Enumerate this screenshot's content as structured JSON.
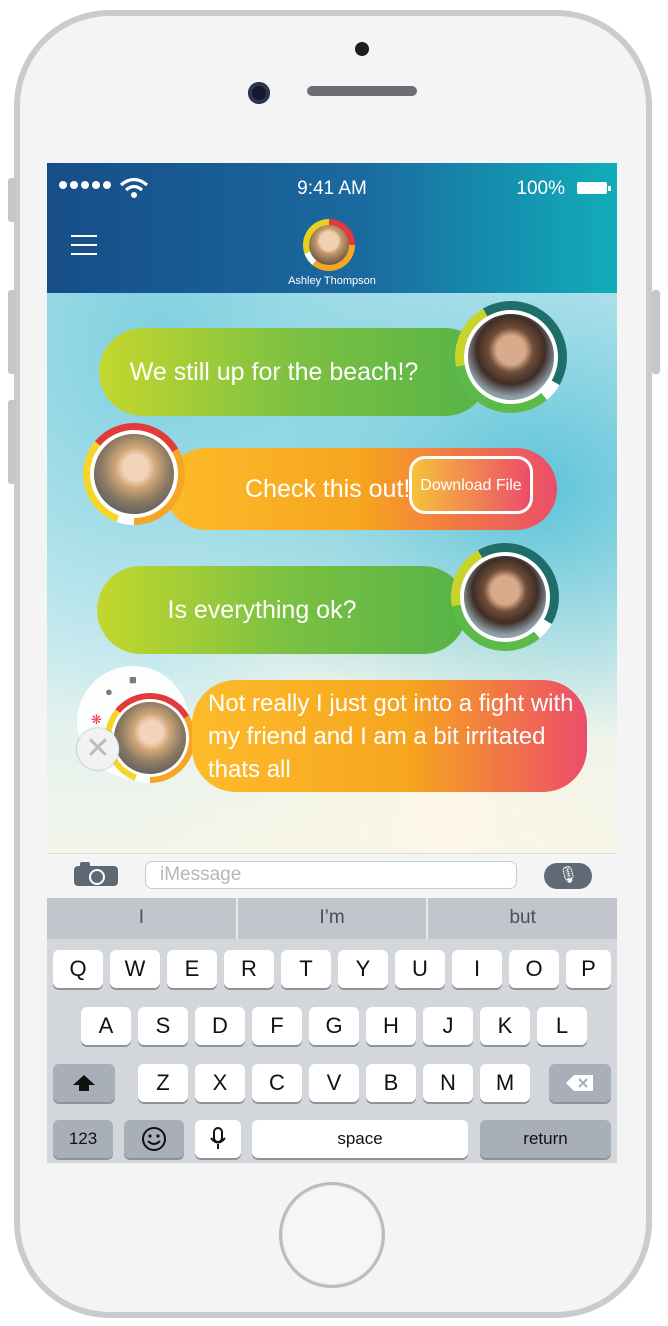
{
  "status_bar": {
    "time": "9:41 AM",
    "battery": "100%"
  },
  "header": {
    "contact_name": "Ashley Thompson"
  },
  "messages": [
    {
      "text": "We still up for the beach!?",
      "from": "other"
    },
    {
      "text": "Check this out!!",
      "from": "me",
      "action": "Download File"
    },
    {
      "text": "Is everything ok?",
      "from": "other"
    },
    {
      "text": "Not really I just got into a fight with my friend and I am a bit irritated thats all",
      "from": "me"
    }
  ],
  "composer": {
    "placeholder": "iMessage"
  },
  "keyboard": {
    "suggestions": [
      "I",
      "I’m",
      "but"
    ],
    "row1": [
      "Q",
      "W",
      "E",
      "R",
      "T",
      "Y",
      "U",
      "I",
      "O",
      "P"
    ],
    "row2": [
      "A",
      "S",
      "D",
      "F",
      "G",
      "H",
      "J",
      "K",
      "L"
    ],
    "row3": [
      "Z",
      "X",
      "C",
      "V",
      "B",
      "N",
      "M"
    ],
    "numbers_key": "123",
    "space_key": "space",
    "return_key": "return"
  },
  "colors": {
    "header_start": "#174d87",
    "header_end": "#11adb9",
    "bubble_green": "#56b347",
    "bubble_orange": "#f6a51f",
    "bubble_pink": "#ec4d6a"
  }
}
